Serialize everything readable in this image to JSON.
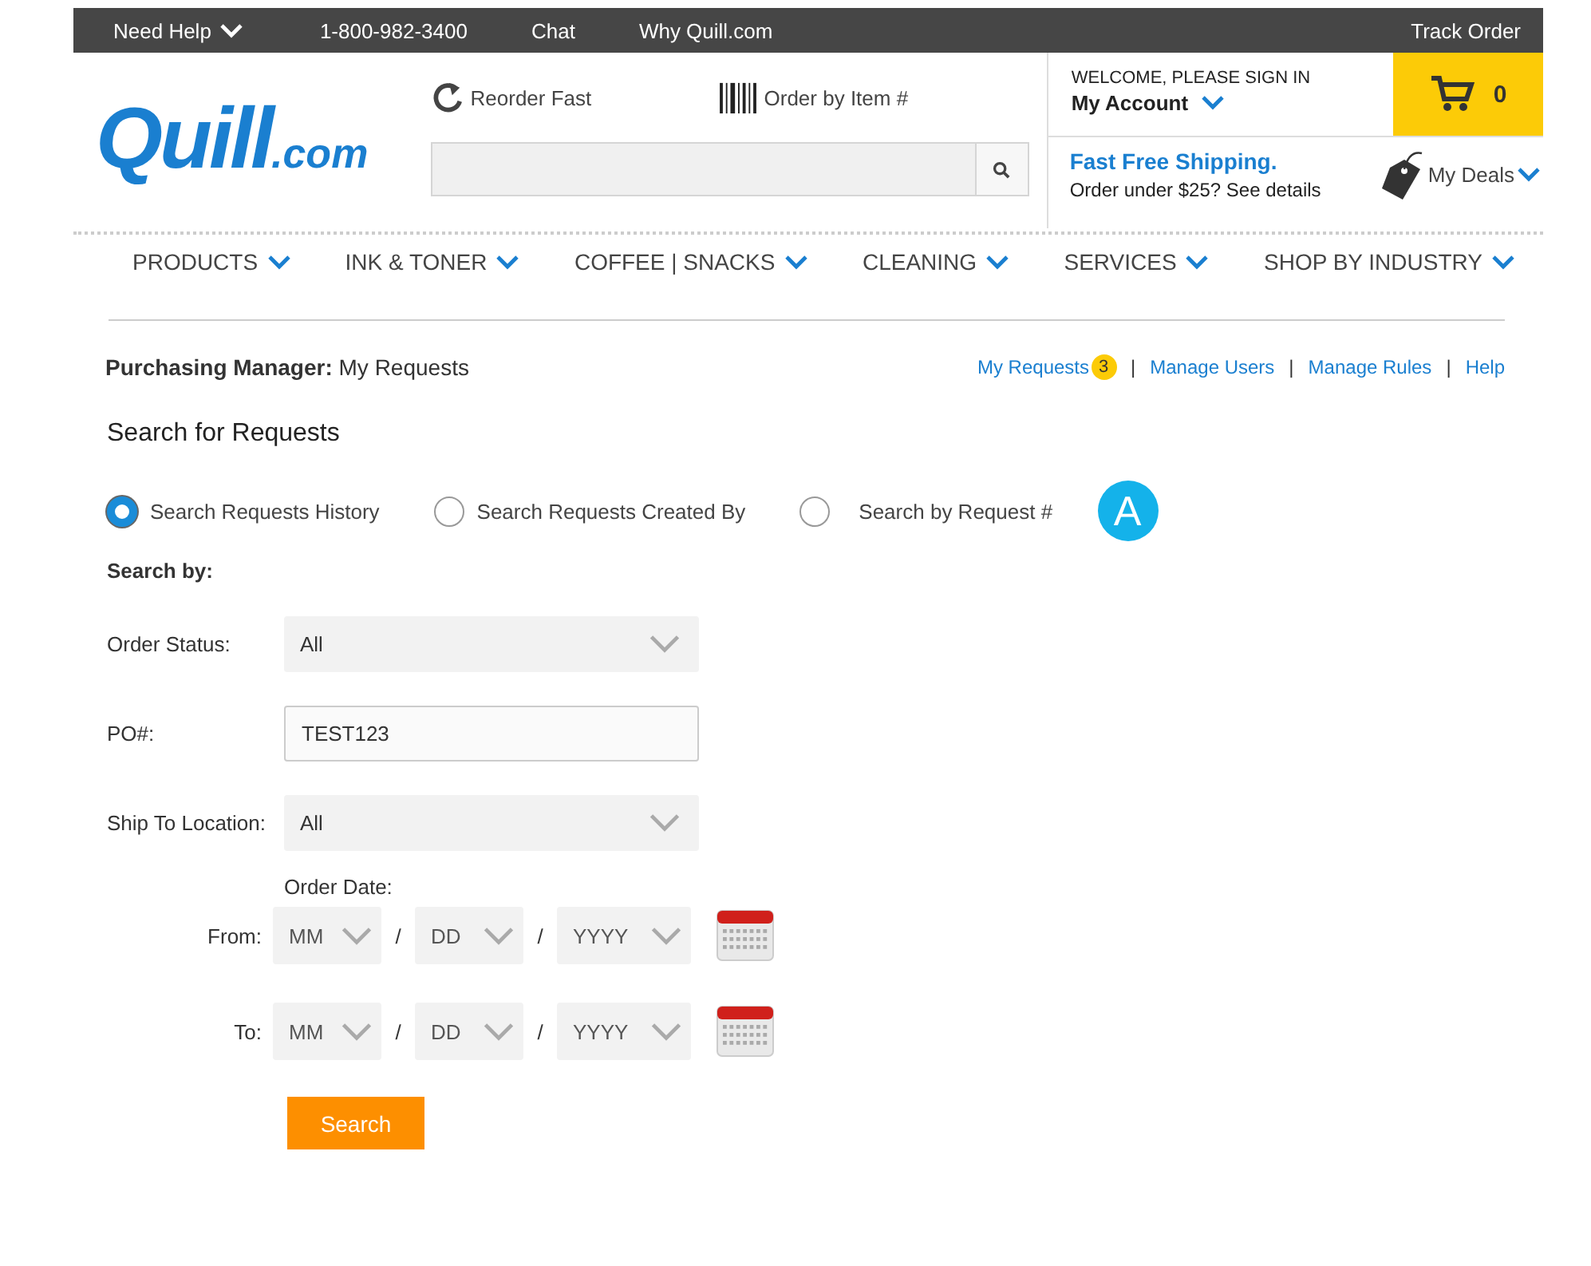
{
  "top_bar": {
    "help": "Need Help",
    "phone": "1-800-982-3400",
    "links": [
      "Chat",
      "Why Quill.com"
    ],
    "track": "Track Order"
  },
  "header": {
    "logo_main": "Quill",
    "logo_suffix": ".com",
    "quick_links": [
      {
        "kind": "reorder",
        "label": "Reorder Fast"
      },
      {
        "kind": "barcode",
        "label": "Order by Item #"
      }
    ],
    "account": {
      "greeting": "WELCOME, PLEASE SIGN IN",
      "label": "My Account"
    },
    "cart": {
      "count": "0"
    },
    "shipping": {
      "title": "Fast Free Shipping.",
      "note": "Order under $25? See details"
    },
    "deals": "My Deals"
  },
  "nav": [
    "PRODUCTS",
    "INK & TONER",
    "COFFEE | SNACKS",
    "CLEANING",
    "SERVICES",
    "SHOP BY INDUSTRY"
  ],
  "page": {
    "title_bold": "Purchasing Manager:",
    "title": "My Requests",
    "link_separator": "|",
    "links": [
      {
        "label": "My Requests",
        "badge": "3"
      },
      {
        "label": "Manage Users"
      },
      {
        "label": "Manage Rules"
      },
      {
        "label": "Help"
      }
    ]
  },
  "search": {
    "heading": "Search for Requests",
    "options": [
      {
        "label": "Search Requests History",
        "selected": true
      },
      {
        "label": "Search Requests Created By",
        "selected": false
      },
      {
        "label": "Search by Request #",
        "selected": false
      }
    ],
    "marker": "A",
    "subheading": "Search by:",
    "fields": [
      {
        "kind": "select",
        "label": "Order Status:",
        "value": "All"
      },
      {
        "kind": "text",
        "label": "PO#:",
        "value": "TEST123"
      },
      {
        "kind": "select",
        "label": "Ship To Location:",
        "value": "All"
      }
    ],
    "date_label": "Order Date:",
    "date_rows": [
      {
        "label": "From:",
        "parts": [
          "MM",
          "DD",
          "YYYY"
        ],
        "separators": [
          "/",
          "/"
        ]
      },
      {
        "label": "To:",
        "parts": [
          "MM",
          "DD",
          "YYYY"
        ],
        "separators": [
          "/",
          "/"
        ]
      }
    ],
    "button": "Search"
  }
}
